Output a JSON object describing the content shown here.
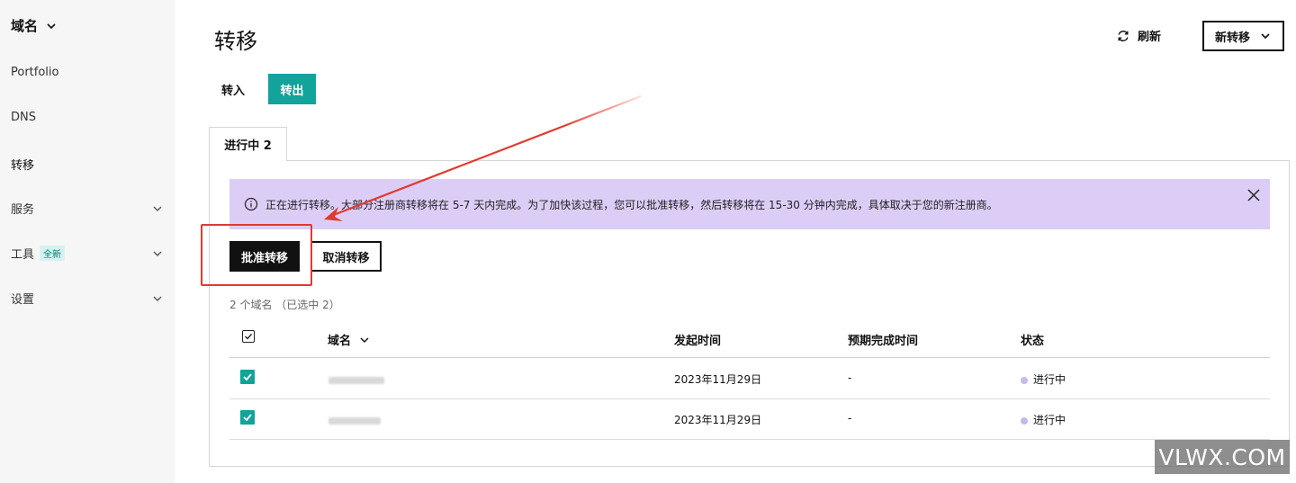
{
  "sidebar": {
    "header": "域名",
    "items": [
      {
        "label": "Portfolio",
        "chevron": false
      },
      {
        "label": "DNS",
        "chevron": false
      },
      {
        "label": "转移",
        "chevron": false,
        "active": true
      },
      {
        "label": "服务",
        "chevron": true
      },
      {
        "label": "工具",
        "chevron": true,
        "badge": "全新"
      },
      {
        "label": "设置",
        "chevron": true
      }
    ]
  },
  "header": {
    "title": "转移",
    "refresh_label": "刷新",
    "new_transfer_label": "新转移"
  },
  "direction_toggle": {
    "in_label": "转入",
    "out_label": "转出",
    "selected": "out"
  },
  "tabs": [
    {
      "label": "进行中 2",
      "active": true
    }
  ],
  "alert": {
    "message": "正在进行转移。大部分注册商转移将在 5-7 天内完成。为了加快该过程，您可以批准转移，然后转移将在 15-30 分钟内完成，具体取决于您的新注册商。",
    "background": "#dccdf6"
  },
  "actions": {
    "approve_label": "批准转移",
    "cancel_label": "取消转移"
  },
  "summary": "2 个域名 （已选中 2）",
  "table": {
    "columns": [
      "域名",
      "发起时间",
      "预期完成时间",
      "状态"
    ],
    "rows": [
      {
        "domain": "",
        "initiated": "2023年11月29日",
        "expected": "-",
        "status": "进行中",
        "checked": true
      },
      {
        "domain": "",
        "initiated": "2023年11月29日",
        "expected": "-",
        "status": "进行中",
        "checked": true
      }
    ]
  },
  "watermark": "VLWX.COM",
  "colors": {
    "accent": "#12a39a",
    "annotation": "#e03a2f",
    "status_dot": "#c9b7ef"
  }
}
